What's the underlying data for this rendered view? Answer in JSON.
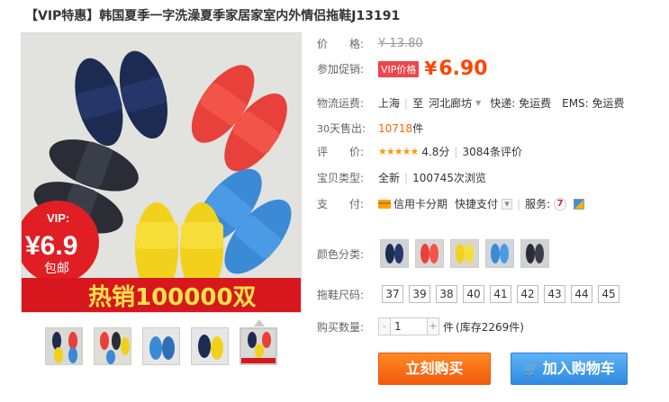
{
  "title": "【VIP特惠】韩国夏季一字洗澡夏季家居家室内外情侣拖鞋J13191",
  "main_image": {
    "vip_badge": "VIP:",
    "badge_price": "¥6.9",
    "badge_sub": "包邮",
    "banner": "热销100000双"
  },
  "price": {
    "label": "价　　格:",
    "original": "¥ 13.80"
  },
  "promo": {
    "label": "参加促销:",
    "tag": "VIP价格",
    "currency": "¥",
    "value": "6.90"
  },
  "shipping": {
    "label": "物流运费:",
    "from": "上海",
    "sep": "|",
    "to_prefix": "至",
    "to": "河北廊坊",
    "express": "快递: 免运费",
    "ems": "EMS: 免运费"
  },
  "sales": {
    "label_prefix": "30",
    "label": "天售出:",
    "value": "10718",
    "unit": "件"
  },
  "rating": {
    "label": "评　　价:",
    "stars": "★★★★★",
    "score": "4.8分",
    "sep": "|",
    "reviews": "3084条评价"
  },
  "item_type": {
    "label": "宝贝类型:",
    "value": "全新",
    "sep": "|",
    "views": "100745次浏览"
  },
  "payment": {
    "label": "支　　付:",
    "method1": "信用卡分期",
    "method2": "快捷支付",
    "service_label": "服务:",
    "icon_7": "7"
  },
  "colors": {
    "label": "颜色分类:",
    "swatches": [
      "dark-navy",
      "red",
      "yellow",
      "blue",
      "black"
    ]
  },
  "sizes": {
    "label": "拖鞋尺码:",
    "options": [
      "37",
      "39",
      "38",
      "40",
      "41",
      "42",
      "43",
      "44",
      "45"
    ]
  },
  "quantity": {
    "label": "购买数量:",
    "minus": "-",
    "value": "1",
    "plus": "+",
    "unit": "件",
    "stock": "(库存2269件)"
  },
  "actions": {
    "buy": "立刻购买",
    "cart": "加入购物车"
  },
  "brand_colors": {
    "price": "#ff4400",
    "buy_button": "#f8751a",
    "cart_button": "#3d97e8"
  }
}
